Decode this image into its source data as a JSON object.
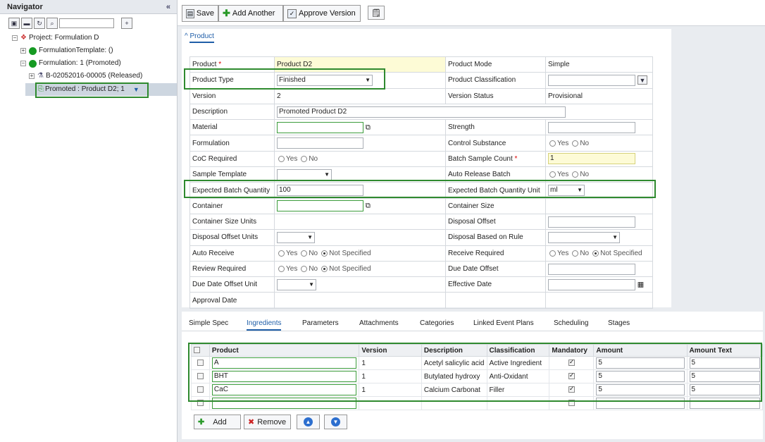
{
  "navigator": {
    "title": "Navigator",
    "collapse": "«",
    "tree": [
      {
        "label": "Project: Formulation D",
        "expander": "⊟"
      },
      {
        "label": "FormulationTemplate: ()",
        "expander": "⊞"
      },
      {
        "label": "Formulation: 1 (Promoted)",
        "expander": "⊟"
      },
      {
        "label": "B-02052016-00005 (Released)",
        "expander": "⊞"
      },
      {
        "label": "Promoted : Product D2; 1",
        "expander": ""
      }
    ]
  },
  "toolbar": {
    "save": "Save",
    "add_another": "Add Another",
    "approve_version": "Approve Version"
  },
  "section": {
    "title": "Product"
  },
  "form": {
    "product_label": "Product",
    "product_value": "Product D2",
    "product_mode_label": "Product Mode",
    "product_mode_value": "Simple",
    "product_type_label": "Product Type",
    "product_type_value": "Finished",
    "product_class_label": "Product Classification",
    "product_class_value": "",
    "version_label": "Version",
    "version_value": "2",
    "version_status_label": "Version Status",
    "version_status_value": "Provisional",
    "description_label": "Description",
    "description_value": "Promoted Product D2",
    "material_label": "Material",
    "strength_label": "Strength",
    "formulation_label": "Formulation",
    "control_substance_label": "Control Substance",
    "coc_label": "CoC Required",
    "batch_sample_label": "Batch Sample Count",
    "batch_sample_value": "1",
    "sample_template_label": "Sample Template",
    "auto_release_label": "Auto Release Batch",
    "ebq_label": "Expected Batch Quantity",
    "ebq_value": "100",
    "ebq_unit_label": "Expected Batch Quantity Unit",
    "ebq_unit_value": "ml",
    "container_label": "Container",
    "container_size_label": "Container Size",
    "container_size_units_label": "Container Size Units",
    "disposal_offset_label": "Disposal Offset",
    "disposal_offset_units_label": "Disposal Offset Units",
    "disposal_rule_label": "Disposal Based on Rule",
    "auto_receive_label": "Auto Receive",
    "receive_required_label": "Receive Required",
    "review_required_label": "Review Required",
    "due_date_offset_label": "Due Date Offset",
    "due_date_offset_unit_label": "Due Date Offset Unit",
    "effective_date_label": "Effective Date",
    "approval_date_label": "Approval Date",
    "yes": "Yes",
    "no": "No",
    "not_specified": "Not Specified"
  },
  "tabs": [
    "Simple Spec",
    "Ingredients",
    "Parameters",
    "Attachments",
    "Categories",
    "Linked Event Plans",
    "Scheduling",
    "Stages"
  ],
  "grid": {
    "headers": [
      "Product",
      "Version",
      "Description",
      "Classification",
      "Mandatory",
      "Amount",
      "Amount Text"
    ],
    "rows": [
      {
        "product": "A",
        "version": "1",
        "description": "Acetyl salicylic acid",
        "classification": "Active Ingredient",
        "mandatory": true,
        "amount": "5",
        "amount_text": "5"
      },
      {
        "product": "BHT",
        "version": "1",
        "description": "Butylated hydroxy",
        "classification": "Anti-Oxidant",
        "mandatory": true,
        "amount": "5",
        "amount_text": "5"
      },
      {
        "product": "CaC",
        "version": "1",
        "description": "Calcium Carbonat",
        "classification": "Filler",
        "mandatory": true,
        "amount": "5",
        "amount_text": "5"
      }
    ]
  },
  "grid_buttons": {
    "add": "Add",
    "remove": "Remove"
  }
}
